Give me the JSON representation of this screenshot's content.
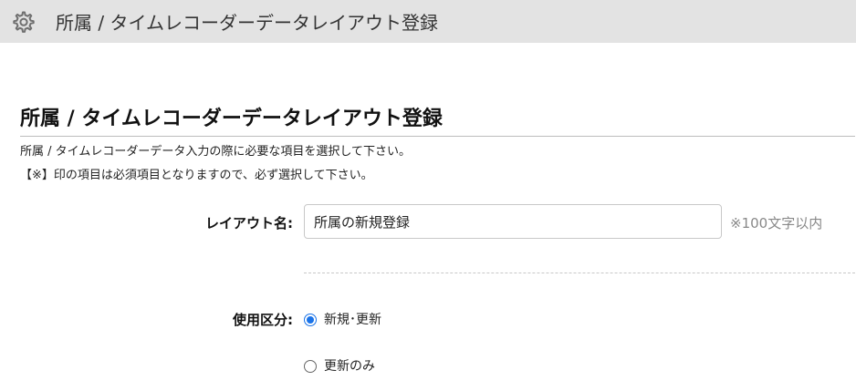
{
  "header": {
    "title": "所属 / タイムレコーダーデータレイアウト登録",
    "icon": "gear-icon"
  },
  "page": {
    "heading": "所属 / タイムレコーダーデータレイアウト登録",
    "description_line1": "所属 / タイムレコーダーデータ入力の際に必要な項目を選択して下さい。",
    "description_line2": "【※】印の項目は必須項目となりますので、必ず選択して下さい。"
  },
  "form": {
    "layout_name": {
      "label": "レイアウト名:",
      "value": "所属の新規登録",
      "hint": "※100文字以内"
    },
    "usage": {
      "label": "使用区分:",
      "options": [
        {
          "label": "新規･更新",
          "checked": true
        },
        {
          "label": "更新のみ",
          "checked": false
        }
      ]
    }
  },
  "colors": {
    "titlebar_bg": "#e3e3e3",
    "radio_accent": "#1a73e8",
    "hint_text": "#888888"
  }
}
